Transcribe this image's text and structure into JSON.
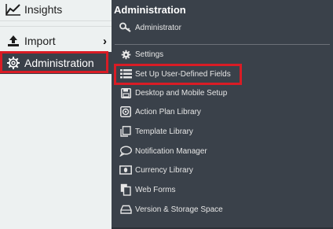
{
  "left_menu": {
    "items": [
      {
        "label": "Insights",
        "icon": "chart-line-icon"
      },
      {
        "label": "Import",
        "icon": "upload-icon",
        "chevron": "›"
      },
      {
        "label": "Administration",
        "icon": "gear-icon"
      }
    ]
  },
  "flyout": {
    "title": "Administration",
    "items": [
      {
        "label": "Administrator",
        "icon": "key-icon"
      },
      {
        "label": "Settings",
        "icon": "gear-icon"
      },
      {
        "label": "Set Up User-Defined Fields",
        "icon": "list-icon"
      },
      {
        "label": "Desktop and Mobile Setup",
        "icon": "floppy-icon"
      },
      {
        "label": "Action Plan Library",
        "icon": "target-icon"
      },
      {
        "label": "Template Library",
        "icon": "template-icon"
      },
      {
        "label": "Notification Manager",
        "icon": "speech-bubble-icon"
      },
      {
        "label": "Currency Library",
        "icon": "currency-icon"
      },
      {
        "label": "Web Forms",
        "icon": "document-icon"
      },
      {
        "label": "Version & Storage Space",
        "icon": "storage-icon"
      }
    ]
  },
  "colors": {
    "sidebar_bg": "#edf1f1",
    "active_bg": "#3a4049",
    "flyout_bg": "#3a414a",
    "highlight": "#d91c25"
  }
}
